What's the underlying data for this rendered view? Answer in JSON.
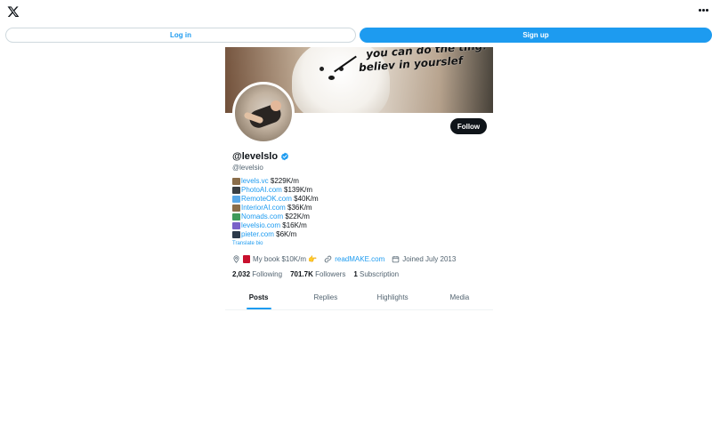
{
  "header": {
    "logo_icon": "x-logo-icon",
    "more_icon": "more-dots-icon",
    "login_label": "Log in",
    "signup_label": "Sign up"
  },
  "banner": {
    "caption_line1": "you can do the ting!",
    "caption_line2": "believ in yourslef"
  },
  "profile": {
    "follow_label": "Follow",
    "display_name": "@levelslo",
    "handle": "@levelsio",
    "verified_icon": "verified-badge-icon",
    "bio": [
      {
        "icon": "house-emoji",
        "link": "levels.vc",
        "text": " $229K/m"
      },
      {
        "icon": "camera-emoji",
        "link": "PhotoAI.com",
        "text": " $139K/m"
      },
      {
        "icon": "sparkles-emoji",
        "link": "RemoteOK.com",
        "text": " $40K/m"
      },
      {
        "icon": "house-emoji",
        "link": "InteriorAI.com",
        "text": " $36K/m"
      },
      {
        "icon": "globe-emoji",
        "link": "Nomads.com",
        "text": " $22K/m"
      },
      {
        "icon": "test-tube-emoji",
        "link": "levelsio.com",
        "text": " $16K/m"
      },
      {
        "icon": "floppy-emoji",
        "link": "pieter.com",
        "text": " $6K/m"
      }
    ],
    "translate_label": "Translate bio",
    "location_text": "My book $10K/m 👉",
    "website_text": "readMAKE.com",
    "joined_text": "Joined July 2013",
    "following_count": "2,032",
    "following_label": "Following",
    "followers_count": "701.7K",
    "followers_label": "Followers",
    "subscription_count": "1",
    "subscription_label": "Subscription"
  },
  "tabs": [
    {
      "label": "Posts",
      "active": true
    },
    {
      "label": "Replies",
      "active": false
    },
    {
      "label": "Highlights",
      "active": false
    },
    {
      "label": "Media",
      "active": false
    }
  ],
  "colors": {
    "accent": "#1d9bf0",
    "text": "#0f1419",
    "muted": "#536471"
  }
}
